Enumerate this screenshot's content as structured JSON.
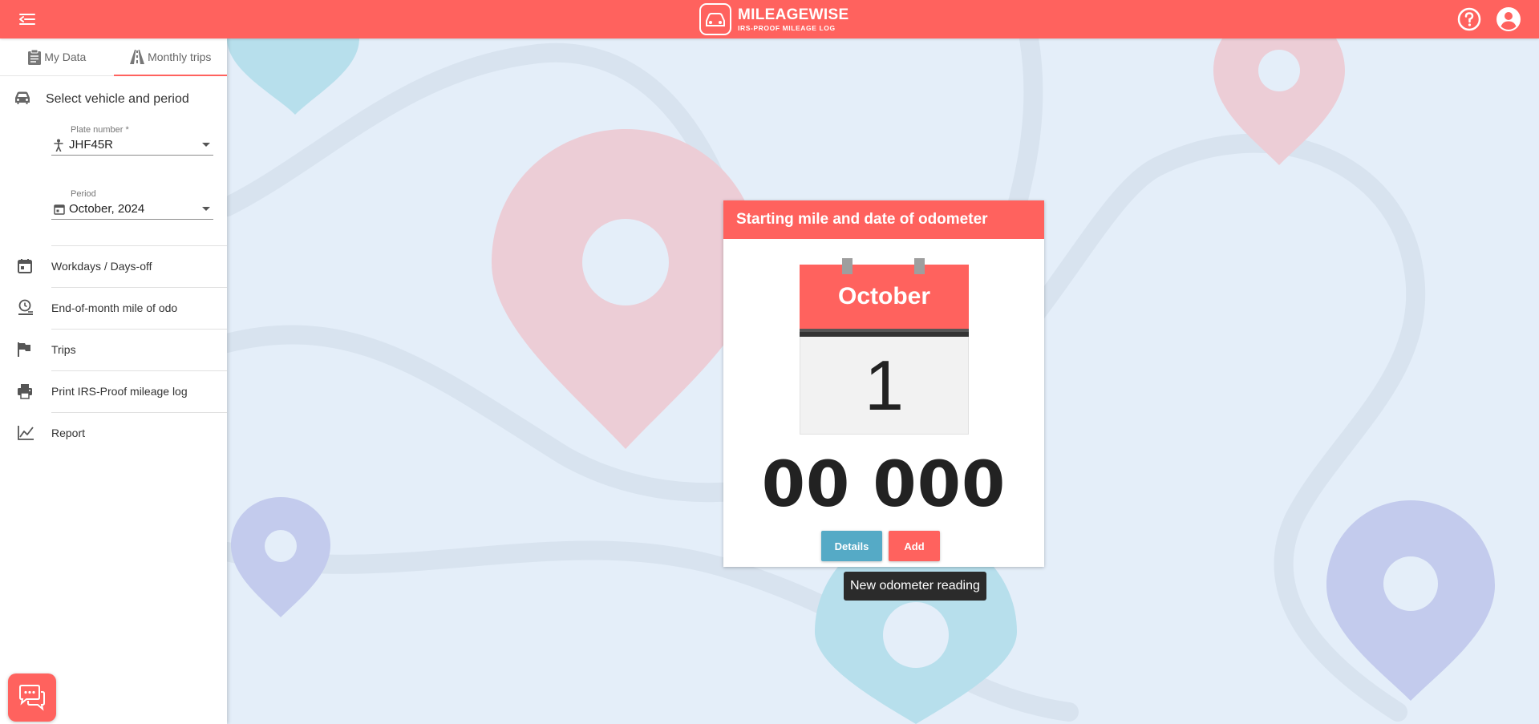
{
  "header": {
    "logo_title": "MILEAGEWISE",
    "logo_subtitle": "IRS-PROOF MILEAGE LOG",
    "back_icon": "menu-collapse-icon",
    "help_icon": "help-circle-icon",
    "account_icon": "account-circle-icon",
    "brand_color": "#ff625e"
  },
  "sidebar": {
    "tabs": [
      {
        "label": "My Data",
        "icon": "clipboard-icon",
        "active": false
      },
      {
        "label": "Monthly trips",
        "icon": "road-icon",
        "active": true
      }
    ],
    "section_title": "Select vehicle and period",
    "plate": {
      "label": "Plate number *",
      "value": "JHF45R"
    },
    "period": {
      "label": "Period",
      "value": "October, 2024"
    },
    "menu": [
      {
        "label": "Workdays / Days-off",
        "icon": "calendar-icon"
      },
      {
        "label": "End-of-month mile of odo",
        "icon": "odometer-clock-icon"
      },
      {
        "label": "Trips",
        "icon": "flag-icon"
      },
      {
        "label": "Print IRS-Proof mileage log",
        "icon": "printer-icon"
      },
      {
        "label": "Report",
        "icon": "chart-line-icon"
      }
    ],
    "chat_icon": "chat-bubbles-icon"
  },
  "card": {
    "title": "Starting mile and date of odometer",
    "month": "October",
    "day": "1",
    "odometer": "00 000",
    "details_label": "Details",
    "add_label": "Add"
  },
  "tooltip": "New odometer reading",
  "colors": {
    "accent": "#ff625e",
    "details_button": "#55aac6",
    "background": "#e4eef9"
  }
}
